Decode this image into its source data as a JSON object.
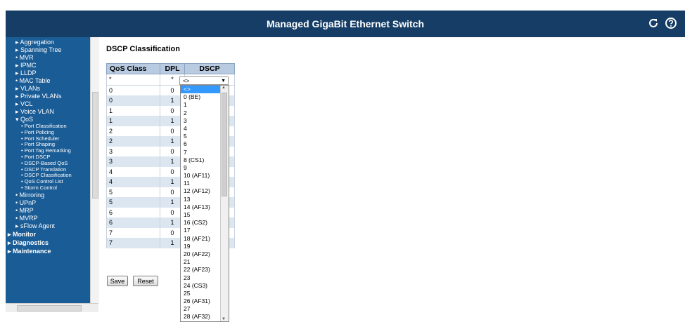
{
  "header": {
    "title": "Managed GigaBit Ethernet Switch"
  },
  "sidebar": {
    "items": [
      {
        "label": "▸ Aggregation",
        "level": 1
      },
      {
        "label": "▸ Spanning Tree",
        "level": 1
      },
      {
        "label": "• MVR",
        "level": 1
      },
      {
        "label": "▸ IPMC",
        "level": 1
      },
      {
        "label": "▸ LLDP",
        "level": 1
      },
      {
        "label": "• MAC Table",
        "level": 1
      },
      {
        "label": "▸ VLANs",
        "level": 1
      },
      {
        "label": "▸ Private VLANs",
        "level": 1
      },
      {
        "label": "▸ VCL",
        "level": 1
      },
      {
        "label": "▸ Voice VLAN",
        "level": 1
      },
      {
        "label": "▾ QoS",
        "level": 1
      },
      {
        "label": "• Port Classification",
        "level": 2
      },
      {
        "label": "• Port Policing",
        "level": 2
      },
      {
        "label": "• Port Scheduler",
        "level": 2
      },
      {
        "label": "• Port Shaping",
        "level": 2
      },
      {
        "label": "• Port Tag Remarking",
        "level": 2
      },
      {
        "label": "• Port DSCP",
        "level": 2
      },
      {
        "label": "• DSCP-Based QoS",
        "level": 2
      },
      {
        "label": "• DSCP Translation",
        "level": 2
      },
      {
        "label": "• DSCP Classification",
        "level": 2
      },
      {
        "label": "• QoS Control List",
        "level": 2
      },
      {
        "label": "• Storm Control",
        "level": 2
      },
      {
        "label": "• Mirroring",
        "level": 1
      },
      {
        "label": "• UPnP",
        "level": 1
      },
      {
        "label": "• MRP",
        "level": 1
      },
      {
        "label": "• MVRP",
        "level": 1
      },
      {
        "label": "▸ sFlow Agent",
        "level": 1
      },
      {
        "label": "▸ Monitor",
        "level": 0
      },
      {
        "label": "▸ Diagnostics",
        "level": 0
      },
      {
        "label": "▸ Maintenance",
        "level": 0
      }
    ]
  },
  "page": {
    "title": "DSCP Classification"
  },
  "table": {
    "headers": {
      "qos_class": "QoS Class",
      "dpl": "DPL",
      "dscp": "DSCP"
    },
    "filter_row": {
      "qos_class": "*",
      "dpl": "*",
      "dscp_value": "<>"
    },
    "rows": [
      {
        "qos_class": "0",
        "dpl": "0"
      },
      {
        "qos_class": "0",
        "dpl": "1"
      },
      {
        "qos_class": "1",
        "dpl": "0"
      },
      {
        "qos_class": "1",
        "dpl": "1"
      },
      {
        "qos_class": "2",
        "dpl": "0"
      },
      {
        "qos_class": "2",
        "dpl": "1"
      },
      {
        "qos_class": "3",
        "dpl": "0"
      },
      {
        "qos_class": "3",
        "dpl": "1"
      },
      {
        "qos_class": "4",
        "dpl": "0"
      },
      {
        "qos_class": "4",
        "dpl": "1"
      },
      {
        "qos_class": "5",
        "dpl": "0"
      },
      {
        "qos_class": "5",
        "dpl": "1"
      },
      {
        "qos_class": "6",
        "dpl": "0"
      },
      {
        "qos_class": "6",
        "dpl": "1"
      },
      {
        "qos_class": "7",
        "dpl": "0"
      },
      {
        "qos_class": "7",
        "dpl": "1"
      }
    ]
  },
  "dscp_dropdown": {
    "selected": "<>",
    "options": [
      "<>",
      "0  (BE)",
      "1",
      "2",
      "3",
      "4",
      "5",
      "6",
      "7",
      "8  (CS1)",
      "9",
      "10 (AF11)",
      "11",
      "12 (AF12)",
      "13",
      "14 (AF13)",
      "15",
      "16 (CS2)",
      "17",
      "18 (AF21)",
      "19",
      "20 (AF22)",
      "21",
      "22 (AF23)",
      "23",
      "24 (CS3)",
      "25",
      "26 (AF31)",
      "27",
      "28 (AF32)"
    ]
  },
  "buttons": {
    "save": "Save",
    "reset": "Reset"
  },
  "colors": {
    "header_bg": "#153d66",
    "sidebar_bg": "#1a5c96",
    "table_header_bg": "#b9cbe0",
    "row_alt_bg": "#dce6f1",
    "selected_option_bg": "#3399ff"
  }
}
